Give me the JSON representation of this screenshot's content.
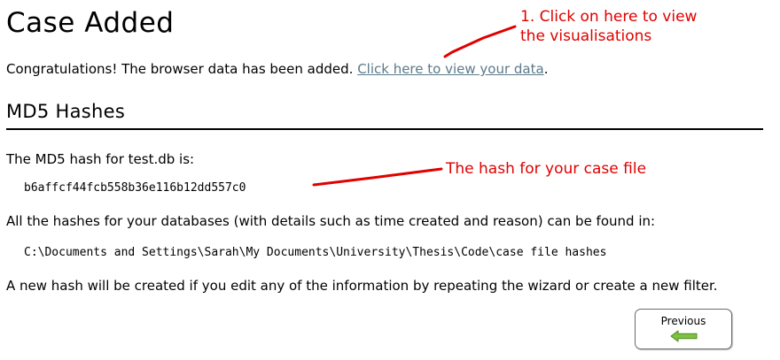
{
  "page": {
    "title": "Case Added"
  },
  "congrats": {
    "message": "Congratulations! The browser data has been added. ",
    "link_text": "Click here to view your data",
    "trailing": "."
  },
  "hashes": {
    "heading": "MD5 Hashes",
    "intro": "The MD5 hash for test.db is:",
    "value": "b6affcf44fcb558b36e116b12dd557c0",
    "location_text": "All the hashes for your databases (with details such as time created and reason) can be found in:",
    "path": "C:\\Documents and Settings\\Sarah\\My Documents\\University\\Thesis\\Code\\case file hashes",
    "note": "A new hash will be created if you edit any of the information by repeating the wizard or create a new filter."
  },
  "annotations": {
    "visualisations_line1": "1. Click on here to view",
    "visualisations_line2": "the visualisations",
    "hash_note": "The hash for your case file",
    "color": "#e00000"
  },
  "navigation": {
    "previous_label": "Previous",
    "previous_icon": "left-arrow-icon",
    "icon_color": "#7dc242"
  }
}
